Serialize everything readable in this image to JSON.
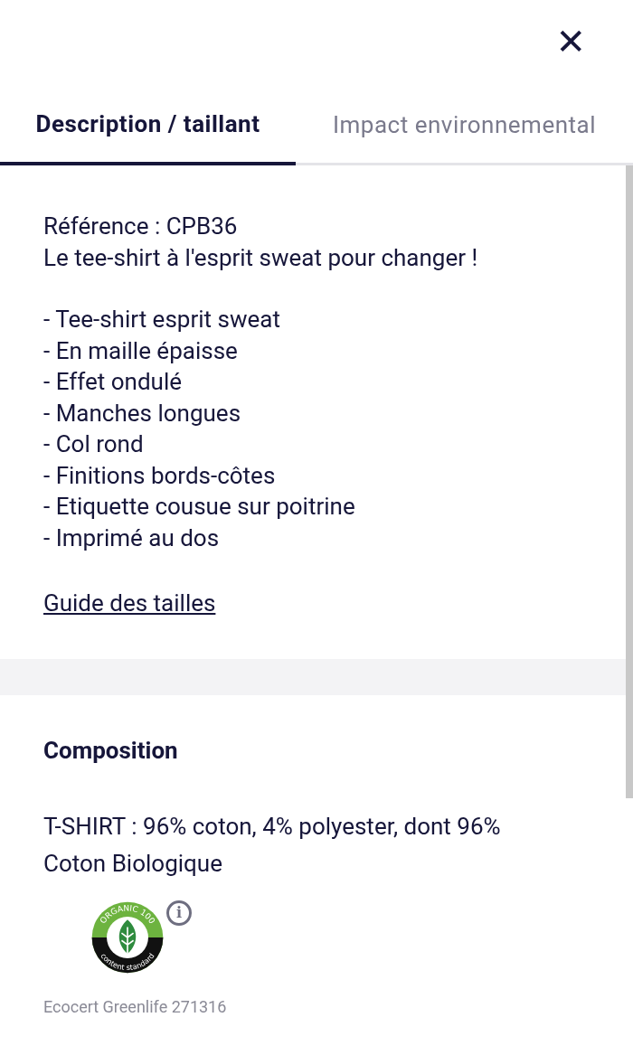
{
  "close_label": "✕",
  "tabs": [
    {
      "label": "Description / taillant",
      "selected": true
    },
    {
      "label": "Impact environnemental",
      "selected": false
    }
  ],
  "description": {
    "reference": "Référence : CPB36",
    "tagline": "Le tee-shirt à l'esprit sweat pour changer !",
    "features": [
      "- Tee-shirt esprit sweat",
      "- En maille épaisse",
      "- Effet ondulé",
      "- Manches longues",
      "- Col rond",
      "- Finitions bords-côtes",
      "- Etiquette cousue sur poitrine",
      "- Imprimé au dos"
    ],
    "size_guide_link": "Guide des tailles"
  },
  "composition": {
    "heading": "Composition",
    "text": "T-SHIRT : 96% coton, 4% polyester, dont 96% Coton Biologique",
    "logo": {
      "top_text": "ORGANIC 100",
      "bottom_text": "content standard"
    },
    "info_label": "i",
    "certifier": "Ecocert Greenlife 271316"
  }
}
